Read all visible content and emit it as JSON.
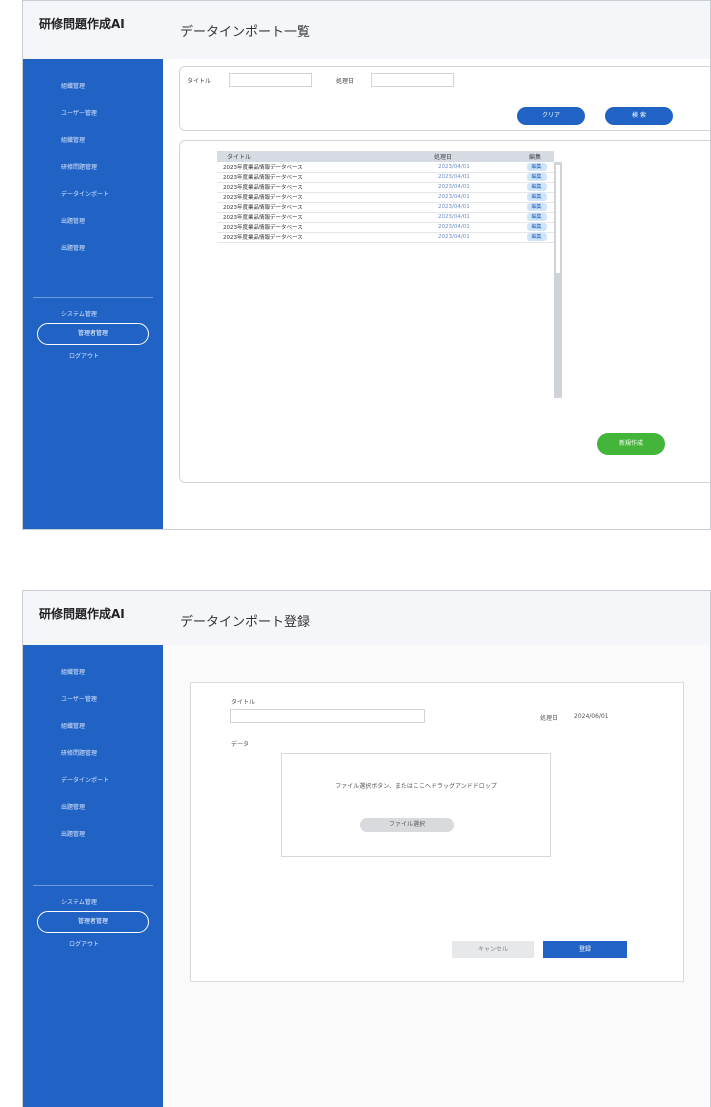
{
  "app_title": "研修問題作成AI",
  "sidebar": {
    "items": [
      "組織管理",
      "ユーザー管理",
      "組織管理",
      "研修問題管理",
      "データインポート",
      "出題管理",
      "出題管理"
    ],
    "system_label": "システム管理",
    "admin_label": "管理者管理",
    "logout_label": "ログアウト"
  },
  "list_screen": {
    "page_title": "データインポート一覧",
    "search": {
      "title_label": "タイトル",
      "title_value": "",
      "date_label": "処理日",
      "date_value": "",
      "clear_label": "クリア",
      "search_label": "検 索"
    },
    "table": {
      "headers": [
        "タイトル",
        "処理日",
        "編集"
      ],
      "rows": [
        {
          "title": "2023年度業品情報データベース",
          "date": "2023/04/01",
          "edit": "編集"
        },
        {
          "title": "2023年度業品情報データベース",
          "date": "2023/04/01",
          "edit": "編集"
        },
        {
          "title": "2023年度業品情報データベース",
          "date": "2023/04/01",
          "edit": "編集"
        },
        {
          "title": "2023年度業品情報データベース",
          "date": "2023/04/01",
          "edit": "編集"
        },
        {
          "title": "2023年度業品情報データベース",
          "date": "2023/04/01",
          "edit": "編集"
        },
        {
          "title": "2023年度業品情報データベース",
          "date": "2023/04/01",
          "edit": "編集"
        },
        {
          "title": "2023年度業品情報データベース",
          "date": "2023/04/01",
          "edit": "編集"
        },
        {
          "title": "2023年度業品情報データベース",
          "date": "2023/04/01",
          "edit": "編集"
        }
      ]
    },
    "new_label": "新規作成"
  },
  "register_screen": {
    "page_title": "データインポート登録",
    "title_label": "タイトル",
    "title_value": "",
    "date_label": "処理日",
    "date_value": "2024/06/01",
    "data_label": "データ",
    "drop_text": "ファイル選択ボタン、またはここへドラッグアンドドロップ",
    "file_select_label": "ファイル選択",
    "cancel_label": "キャンセル",
    "submit_label": "登録"
  },
  "colors": {
    "sidebar": "#2163c4",
    "primary": "#2163c4",
    "success": "#43b53a",
    "header_bg": "#f4f6fa"
  }
}
